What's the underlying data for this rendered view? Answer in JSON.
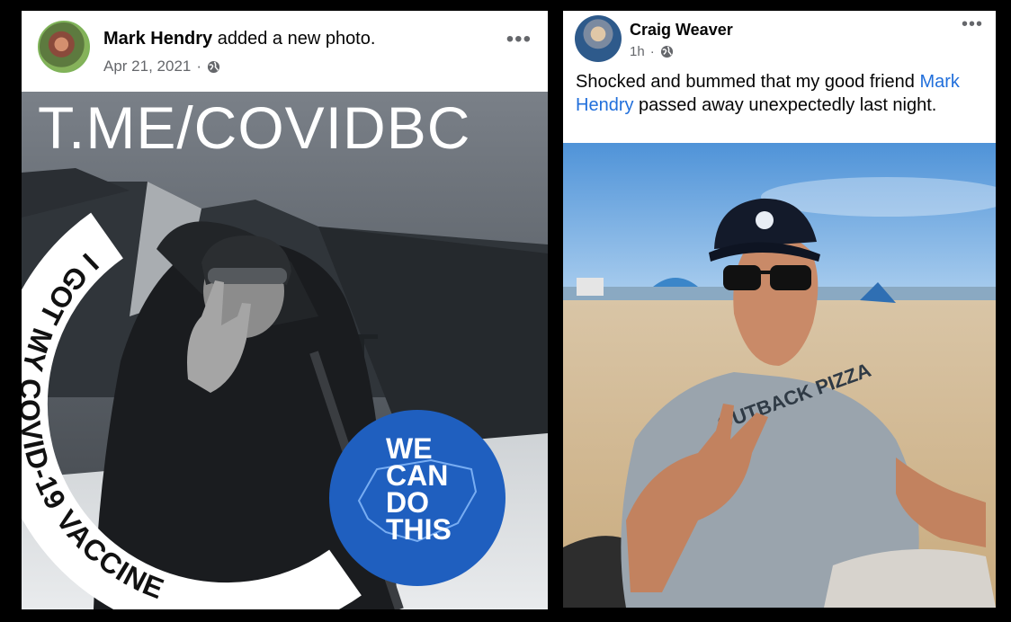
{
  "left_post": {
    "author": "Mark Hendry",
    "action": "added a new photo.",
    "date": "Apr 21, 2021",
    "separator": "·",
    "more": "•••",
    "photo": {
      "overlay_text": "T.ME/COVIDBC",
      "frame_text": "I GOT MY COVID-19 VACCINE",
      "badge_lines": [
        "WE",
        "CAN",
        "DO",
        "THIS"
      ],
      "badge_color": "#1f5fbf"
    }
  },
  "right_post": {
    "author": "Craig Weaver",
    "time": "1h",
    "separator": "·",
    "more": "•••",
    "text_before": "Shocked and bummed that my good friend ",
    "text_link": "Mark Hendry",
    "text_after": " passed away unexpectedly last night.",
    "photo": {
      "shirt_text": "OUTBACK PIZZA"
    }
  },
  "colors": {
    "background": "#000000",
    "link": "#216fdb",
    "secondary_text": "#65676b"
  }
}
